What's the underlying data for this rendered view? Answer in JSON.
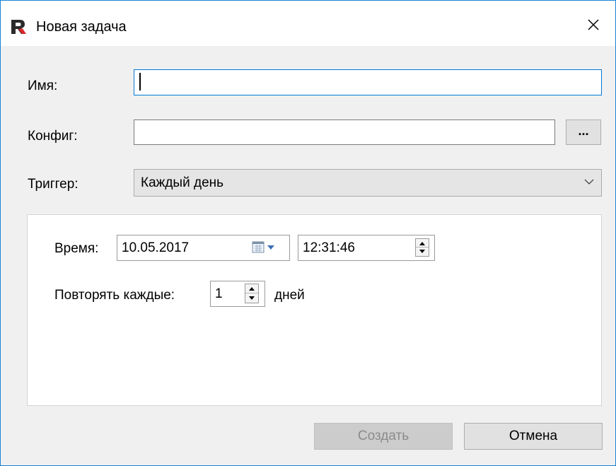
{
  "window": {
    "title": "Новая задача",
    "app_icon": "fastreport-icon",
    "close_icon": "close-icon"
  },
  "form": {
    "name_label": "Имя:",
    "name_value": "",
    "config_label": "Конфиг:",
    "config_value": "",
    "browse_label": "...",
    "trigger_label": "Триггер:",
    "trigger_value": "Каждый день"
  },
  "schedule": {
    "time_label": "Время:",
    "date_value": "10.05.2017",
    "time_value": "12:31:46",
    "repeat_label": "Повторять каждые:",
    "repeat_value": "1",
    "repeat_unit": "дней"
  },
  "buttons": {
    "create_label": "Создать",
    "cancel_label": "Отмена"
  },
  "colors": {
    "accent": "#0078d7",
    "window_border": "#1883d7",
    "logo_red": "#d9252a",
    "disabled_text": "#8b8b8b"
  }
}
